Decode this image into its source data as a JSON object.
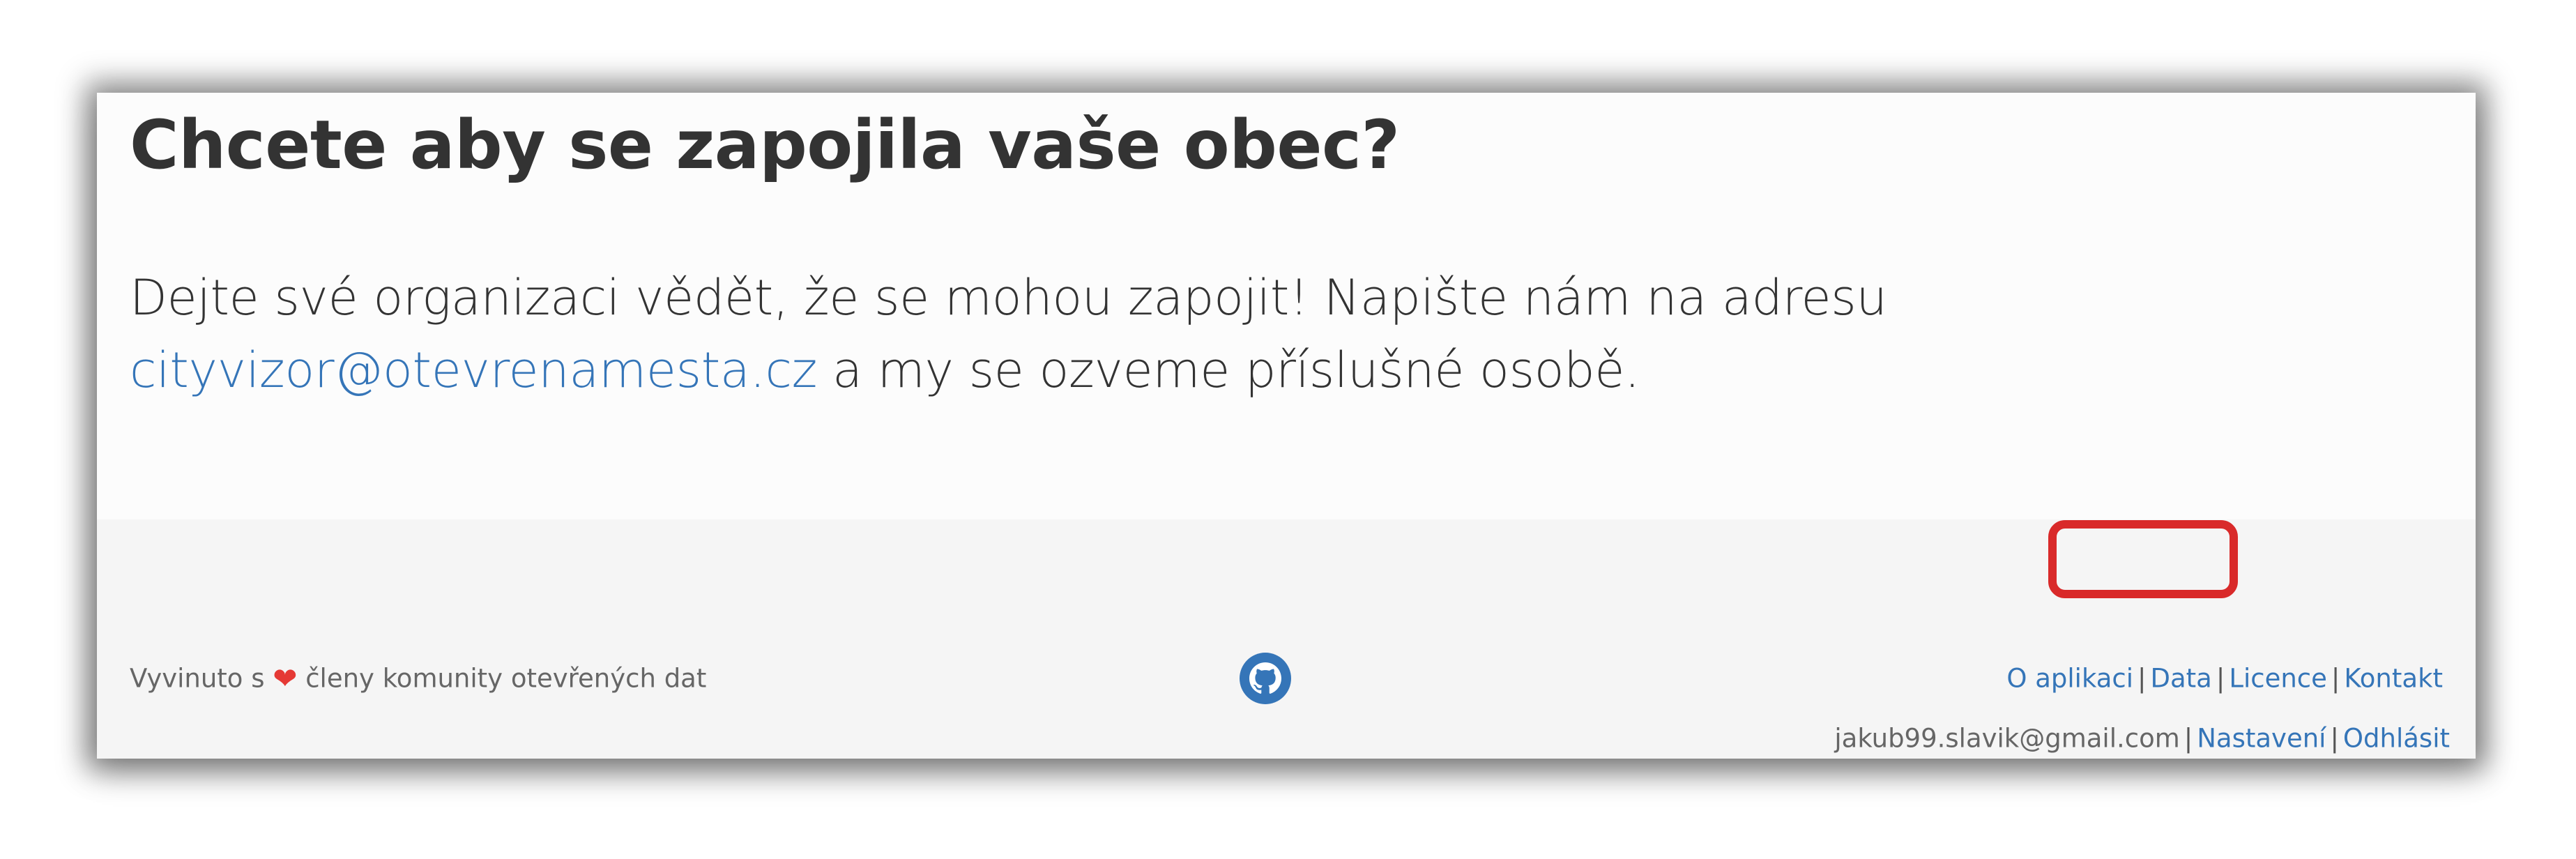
{
  "main": {
    "heading": "Chcete aby se zapojila vaše obec?",
    "text_before": "Dejte své organizaci vědět, že se mohou zapojit! Napište nám na adresu ",
    "email_link": "cityvizor@otevrenamesta.cz",
    "text_after": " a my se ozveme příslušné osobě."
  },
  "footer": {
    "credit_before": "Vyvinuto s ",
    "heart_icon": "heart-icon",
    "credit_after": " členy komunity otevřených dat",
    "github_icon": "github-icon",
    "links": {
      "about": "O aplikaci",
      "data": "Data",
      "license": "Licence",
      "contact": "Kontakt"
    },
    "separator": "|",
    "user": {
      "email": "jakub99.slavik@gmail.com",
      "settings": "Nastavení",
      "logout": "Odhlásit"
    }
  },
  "colors": {
    "link": "#3575b8",
    "highlight": "#d92a2a",
    "heart": "#e53935",
    "footer_bg": "#f5f5f5"
  }
}
